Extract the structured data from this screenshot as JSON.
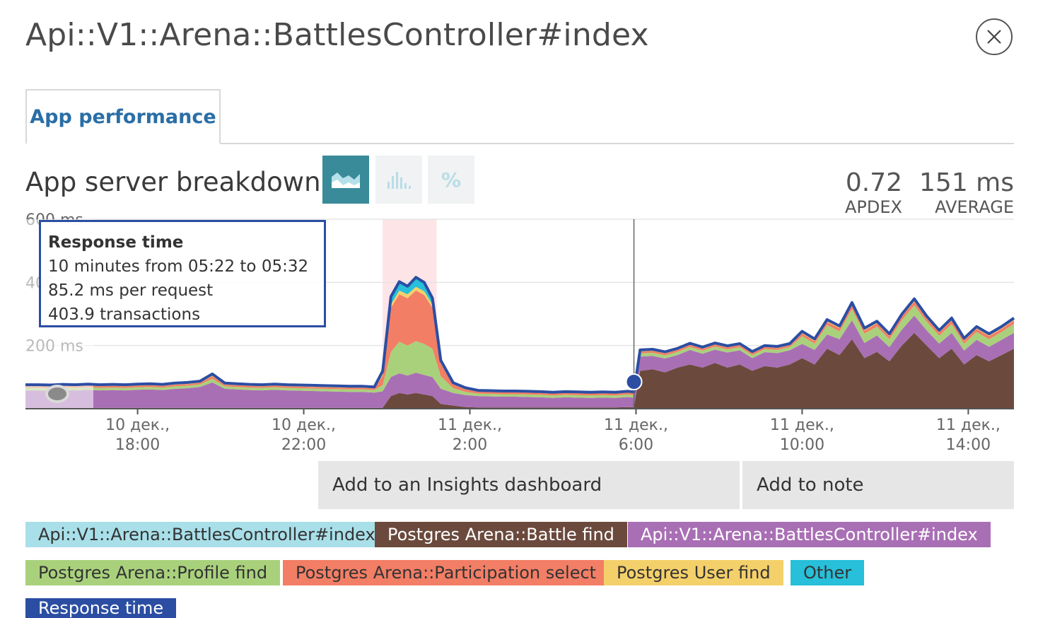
{
  "header": {
    "title": "Api::V1::Arena::BattlesController#index",
    "close_icon": "close-circle-icon"
  },
  "tabs": [
    {
      "label": "App performance",
      "active": true
    }
  ],
  "section": {
    "title": "App server breakdown",
    "view_buttons": [
      {
        "name": "area-chart-view-button",
        "icon": "area-chart-icon",
        "active": true
      },
      {
        "name": "histogram-view-button",
        "icon": "histogram-icon",
        "active": false
      },
      {
        "name": "percentile-view-button",
        "label": "%",
        "icon": "percent-icon",
        "active": false
      }
    ],
    "stats": [
      {
        "value": "0.72",
        "label": "APDEX"
      },
      {
        "value": "151 ms",
        "label": "AVERAGE"
      }
    ]
  },
  "tooltip": {
    "title": "Response time",
    "lines": [
      "10 minutes from 05:22 to 05:32",
      "85.2 ms per request",
      "403.9 transactions"
    ]
  },
  "chart_data": {
    "type": "area",
    "ytick_labels": [
      "600 ms",
      "400 ms",
      "200 ms"
    ],
    "yticks": [
      600,
      400,
      200
    ],
    "ylim": [
      0,
      600
    ],
    "x_tick_labels": [
      [
        "10 дек.,",
        "18:00"
      ],
      [
        "10 дек.,",
        "22:00"
      ],
      [
        "11 дек.,",
        "2:00"
      ],
      [
        "11 дек.,",
        "6:00"
      ],
      [
        "11 дек.,",
        "10:00"
      ],
      [
        "11 дек.,",
        "14:00"
      ]
    ],
    "x_tick_hours": [
      18,
      22,
      26,
      30,
      34,
      38
    ],
    "xlim": [
      15.3,
      39.1
    ],
    "highlight_range": [
      23.9,
      25.2
    ],
    "hover_hour": 29.95,
    "hover_value": 85,
    "grid": true,
    "x": [
      15.3,
      15.6,
      15.9,
      16.2,
      16.5,
      16.8,
      17.1,
      17.4,
      17.7,
      18.0,
      18.3,
      18.6,
      18.9,
      19.2,
      19.5,
      19.8,
      20.1,
      20.4,
      20.7,
      21.0,
      21.3,
      21.6,
      21.9,
      22.2,
      22.5,
      22.8,
      23.1,
      23.4,
      23.7,
      23.9,
      24.1,
      24.3,
      24.5,
      24.7,
      24.9,
      25.1,
      25.3,
      25.6,
      25.9,
      26.2,
      26.5,
      26.8,
      27.1,
      27.4,
      27.7,
      28.0,
      28.3,
      28.6,
      28.9,
      29.2,
      29.5,
      29.8,
      29.95,
      30.1,
      30.4,
      30.7,
      31.0,
      31.3,
      31.6,
      31.9,
      32.2,
      32.5,
      32.8,
      33.1,
      33.4,
      33.7,
      34.0,
      34.3,
      34.6,
      34.9,
      35.2,
      35.5,
      35.8,
      36.1,
      36.4,
      36.7,
      37.0,
      37.3,
      37.6,
      37.9,
      38.2,
      38.5,
      38.8,
      39.1
    ],
    "series": [
      {
        "name": "Postgres Arena::Battle find",
        "color": "#6b4a3d",
        "values": [
          3,
          3,
          3,
          3,
          3,
          3,
          3,
          3,
          3,
          3,
          3,
          3,
          3,
          3,
          3,
          3,
          3,
          3,
          3,
          3,
          3,
          3,
          3,
          3,
          3,
          3,
          3,
          3,
          3,
          3,
          40,
          50,
          45,
          50,
          45,
          40,
          15,
          10,
          5,
          4,
          4,
          4,
          4,
          4,
          4,
          4,
          4,
          4,
          4,
          4,
          4,
          5,
          5,
          120,
          125,
          115,
          130,
          140,
          130,
          145,
          130,
          140,
          120,
          135,
          130,
          140,
          160,
          140,
          190,
          170,
          220,
          160,
          180,
          150,
          200,
          240,
          200,
          160,
          190,
          140,
          170,
          150,
          170,
          190
        ]
      },
      {
        "name": "Api::V1::Arena::BattlesController#index",
        "color": "#a96fb5",
        "values": [
          55,
          55,
          54,
          56,
          55,
          57,
          55,
          56,
          55,
          57,
          58,
          56,
          60,
          62,
          66,
          80,
          60,
          58,
          56,
          55,
          57,
          55,
          54,
          53,
          52,
          51,
          50,
          50,
          48,
          52,
          60,
          62,
          60,
          64,
          62,
          60,
          48,
          40,
          38,
          36,
          35,
          34,
          34,
          33,
          32,
          30,
          32,
          31,
          30,
          31,
          30,
          32,
          30,
          45,
          42,
          44,
          40,
          46,
          44,
          42,
          48,
          45,
          40,
          44,
          46,
          45,
          45,
          46,
          45,
          50,
          60,
          48,
          52,
          45,
          50,
          55,
          48,
          46,
          50,
          44,
          48,
          46,
          48,
          50
        ]
      },
      {
        "name": "Postgres Arena::Profile find",
        "color": "#a9d17c",
        "values": [
          8,
          8,
          8,
          8,
          8,
          8,
          8,
          8,
          8,
          8,
          8,
          8,
          8,
          8,
          8,
          12,
          8,
          8,
          8,
          8,
          8,
          8,
          8,
          8,
          8,
          8,
          8,
          8,
          8,
          20,
          80,
          100,
          95,
          100,
          98,
          90,
          40,
          15,
          10,
          8,
          8,
          8,
          8,
          8,
          8,
          8,
          8,
          8,
          8,
          8,
          8,
          8,
          8,
          10,
          10,
          10,
          10,
          10,
          10,
          10,
          10,
          10,
          10,
          10,
          10,
          10,
          25,
          20,
          30,
          25,
          35,
          30,
          28,
          25,
          30,
          32,
          28,
          25,
          28,
          22,
          25,
          24,
          25,
          28
        ]
      },
      {
        "name": "Postgres Arena::Participation select",
        "color": "#f27e65",
        "values": [
          5,
          5,
          5,
          5,
          5,
          5,
          5,
          5,
          5,
          5,
          5,
          5,
          5,
          5,
          5,
          8,
          5,
          5,
          5,
          5,
          5,
          5,
          5,
          5,
          5,
          5,
          5,
          5,
          5,
          30,
          140,
          150,
          150,
          160,
          155,
          130,
          40,
          12,
          8,
          6,
          6,
          6,
          6,
          6,
          6,
          6,
          6,
          6,
          6,
          6,
          6,
          6,
          6,
          6,
          6,
          6,
          6,
          6,
          6,
          6,
          6,
          6,
          6,
          6,
          6,
          6,
          8,
          8,
          10,
          10,
          12,
          10,
          10,
          10,
          12,
          12,
          10,
          10,
          12,
          10,
          10,
          10,
          10,
          12
        ]
      },
      {
        "name": "Postgres User find",
        "color": "#f4d06a",
        "values": [
          3,
          3,
          3,
          3,
          3,
          3,
          3,
          3,
          3,
          3,
          3,
          3,
          3,
          3,
          3,
          4,
          3,
          3,
          3,
          3,
          3,
          3,
          3,
          3,
          3,
          3,
          3,
          3,
          3,
          6,
          10,
          12,
          12,
          12,
          12,
          10,
          5,
          3,
          3,
          2,
          2,
          2,
          2,
          2,
          2,
          2,
          2,
          2,
          2,
          2,
          2,
          2,
          2,
          3,
          3,
          3,
          3,
          3,
          3,
          3,
          3,
          3,
          3,
          3,
          3,
          3,
          4,
          4,
          4,
          4,
          5,
          4,
          4,
          4,
          4,
          5,
          4,
          4,
          4,
          4,
          4,
          4,
          4,
          4
        ]
      },
      {
        "name": "Other",
        "color": "#27bfd9",
        "values": [
          2,
          2,
          2,
          2,
          2,
          2,
          2,
          2,
          2,
          2,
          2,
          2,
          2,
          2,
          2,
          3,
          2,
          2,
          2,
          2,
          2,
          2,
          2,
          2,
          2,
          2,
          2,
          2,
          2,
          8,
          25,
          28,
          26,
          30,
          28,
          20,
          5,
          2,
          2,
          2,
          2,
          2,
          2,
          2,
          2,
          2,
          2,
          2,
          2,
          2,
          2,
          2,
          2,
          2,
          2,
          2,
          2,
          2,
          2,
          2,
          2,
          2,
          2,
          2,
          2,
          2,
          3,
          3,
          3,
          3,
          4,
          3,
          3,
          3,
          3,
          4,
          3,
          3,
          3,
          3,
          3,
          3,
          3,
          3
        ]
      }
    ],
    "response_time": {
      "name": "Response time",
      "color": "#2b4ea3"
    }
  },
  "actions": [
    {
      "label": "Add to an Insights dashboard"
    },
    {
      "label": "Add to note"
    }
  ],
  "legend": [
    {
      "label": "Api::V1::Arena::BattlesController#index",
      "bg": "#a8dfe9",
      "fg": "#333333"
    },
    {
      "label": "Postgres Arena::Battle find",
      "bg": "#6b4a3d",
      "fg": "#ffffff"
    },
    {
      "label": "Api::V1::Arena::BattlesController#index",
      "bg": "#a96fb5",
      "fg": "#ffffff"
    },
    {
      "label": "Postgres Arena::Profile find",
      "bg": "#a9d17c",
      "fg": "#333333"
    },
    {
      "label": "Postgres Arena::Participation select",
      "bg": "#f27e65",
      "fg": "#333333"
    },
    {
      "label": "Postgres User find",
      "bg": "#f4d06a",
      "fg": "#333333"
    },
    {
      "label": "Other",
      "bg": "#27bfd9",
      "fg": "#333333"
    },
    {
      "label": "Response time",
      "bg": "#2b4ea3",
      "fg": "#ffffff"
    }
  ]
}
